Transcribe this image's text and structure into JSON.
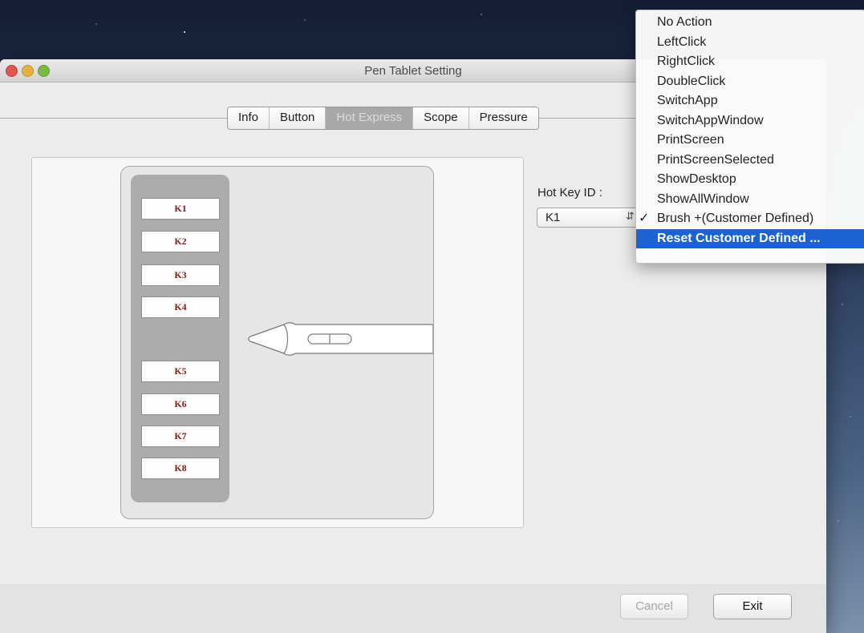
{
  "window": {
    "title": "Pen Tablet Setting"
  },
  "tabs": [
    {
      "label": "Info"
    },
    {
      "label": "Button"
    },
    {
      "label": "Hot Express",
      "active": true
    },
    {
      "label": "Scope"
    },
    {
      "label": "Pressure"
    }
  ],
  "tablet": {
    "keys": [
      "K1",
      "K2",
      "K3",
      "K4",
      "K5",
      "K6",
      "K7",
      "K8"
    ]
  },
  "hotkey": {
    "label": "Hot Key ID :",
    "value": "K1"
  },
  "dropdown_menu": {
    "items": [
      {
        "label": "No Action"
      },
      {
        "label": "LeftClick"
      },
      {
        "label": "RightClick"
      },
      {
        "label": "DoubleClick"
      },
      {
        "label": "SwitchApp"
      },
      {
        "label": "SwitchAppWindow"
      },
      {
        "label": "PrintScreen"
      },
      {
        "label": "PrintScreenSelected"
      },
      {
        "label": "ShowDesktop"
      },
      {
        "label": "ShowAllWindow"
      },
      {
        "label": "Brush +(Customer Defined)",
        "checked": true,
        "check": "✓"
      },
      {
        "label": "Reset Customer Defined ...",
        "highlighted": true
      }
    ]
  },
  "buttons": {
    "cancel": "Cancel",
    "exit": "Exit"
  },
  "colors": {
    "menu_highlight": "#1a63d0",
    "key_text": "#7a1f1f",
    "active_tab": "#a8a8a8"
  }
}
